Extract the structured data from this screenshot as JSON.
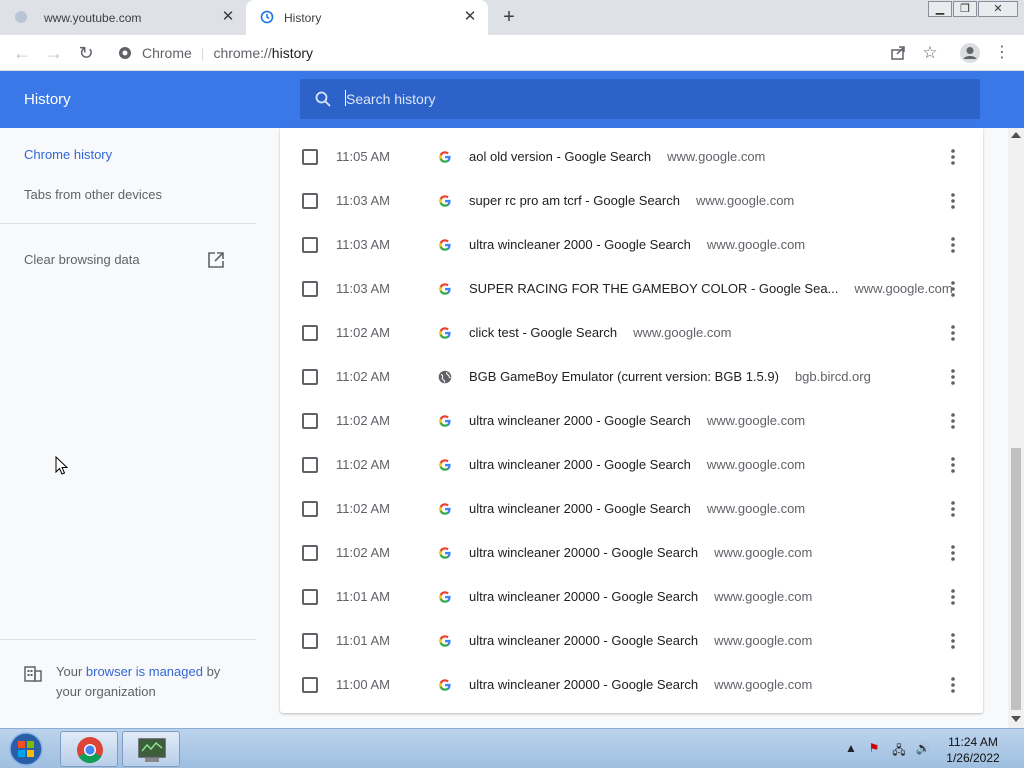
{
  "tabs": [
    {
      "title": "www.youtube.com",
      "active": false
    },
    {
      "title": "History",
      "active": true
    }
  ],
  "new_tab_symbol": "+",
  "toolbar": {
    "omnibox_site": "Chrome",
    "omnibox_url_scheme": "chrome://",
    "omnibox_url_host": "history"
  },
  "history_header": {
    "title": "History",
    "search_placeholder": "Search history"
  },
  "sidebar": {
    "items": [
      {
        "label": "Chrome history",
        "active": true
      },
      {
        "label": "Tabs from other devices",
        "active": false
      }
    ],
    "clear_label": "Clear browsing data",
    "managed_prefix": "Your ",
    "managed_link": "browser is managed",
    "managed_suffix": " by your organization"
  },
  "history": [
    {
      "time": "11:05 AM",
      "title": "aol old version - Google Search",
      "domain": "www.google.com",
      "icon": "google-icon"
    },
    {
      "time": "11:03 AM",
      "title": "super rc pro am tcrf - Google Search",
      "domain": "www.google.com",
      "icon": "google-icon"
    },
    {
      "time": "11:03 AM",
      "title": "ultra wincleaner 2000 - Google Search",
      "domain": "www.google.com",
      "icon": "google-icon"
    },
    {
      "time": "11:03 AM",
      "title": "SUPER RACING FOR THE GAMEBOY COLOR - Google Sea...",
      "domain": "www.google.com",
      "icon": "google-icon"
    },
    {
      "time": "11:02 AM",
      "title": "click test - Google Search",
      "domain": "www.google.com",
      "icon": "google-icon"
    },
    {
      "time": "11:02 AM",
      "title": "BGB GameBoy Emulator (current version: BGB 1.5.9)",
      "domain": "bgb.bircd.org",
      "icon": "globe-icon"
    },
    {
      "time": "11:02 AM",
      "title": "ultra wincleaner 2000 - Google Search",
      "domain": "www.google.com",
      "icon": "google-icon"
    },
    {
      "time": "11:02 AM",
      "title": "ultra wincleaner 2000 - Google Search",
      "domain": "www.google.com",
      "icon": "google-icon"
    },
    {
      "time": "11:02 AM",
      "title": "ultra wincleaner 2000 - Google Search",
      "domain": "www.google.com",
      "icon": "google-icon"
    },
    {
      "time": "11:02 AM",
      "title": "ultra wincleaner 20000 - Google Search",
      "domain": "www.google.com",
      "icon": "google-icon"
    },
    {
      "time": "11:01 AM",
      "title": "ultra wincleaner 20000 - Google Search",
      "domain": "www.google.com",
      "icon": "google-icon"
    },
    {
      "time": "11:01 AM",
      "title": "ultra wincleaner 20000 - Google Search",
      "domain": "www.google.com",
      "icon": "google-icon"
    },
    {
      "time": "11:00 AM",
      "title": "ultra wincleaner 20000 - Google Search",
      "domain": "www.google.com",
      "icon": "google-icon"
    }
  ],
  "taskbar": {
    "time": "11:24 AM",
    "date": "1/26/2022"
  },
  "colors": {
    "header_blue": "#3b78e7",
    "search_blue": "#2d62c8",
    "link_blue": "#3367d6"
  }
}
